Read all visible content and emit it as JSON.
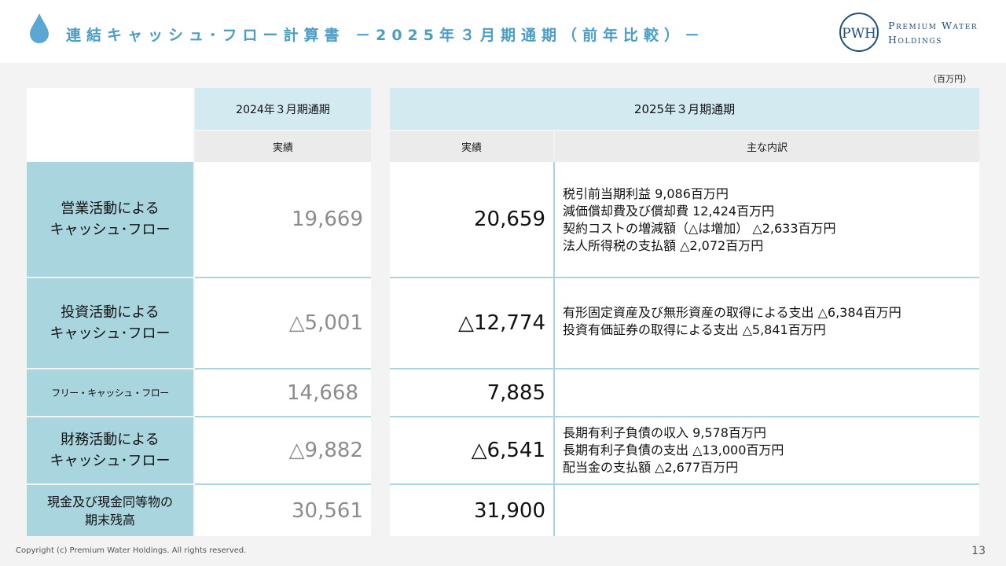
{
  "header": {
    "title": "連結キャッシュ･フロー計算書 －2025年３月期通期（前年比較）－",
    "icon": "water-drop-icon",
    "logo": {
      "monogram": "PWH",
      "line1": "Premium Water",
      "line2": "Holdings"
    }
  },
  "table": {
    "unit": "（百万円）",
    "col_prev_period": "2024年３月期通期",
    "col_curr_period": "2025年３月期通期",
    "sub_actual_prev": "実績",
    "sub_actual_curr": "実績",
    "sub_breakdown": "主な内訳",
    "rows": [
      {
        "label_1": "営業活動による",
        "label_2": "キャッシュ･フロー",
        "prev": "19,669",
        "curr": "20,659",
        "details": [
          "税引前当期利益 9,086百万円",
          "減価償却費及び償却費 12,424百万円",
          "契約コストの増減額（△は増加） △2,633百万円",
          "法人所得税の支払額 △2,072百万円"
        ]
      },
      {
        "label_1": "投資活動による",
        "label_2": "キャッシュ･フロー",
        "prev": "△5,001",
        "curr": "△12,774",
        "details": [
          "有形固定資産及び無形資産の取得による支出 △6,384百万円",
          "投資有価証券の取得による支出 △5,841百万円"
        ]
      },
      {
        "label_1": "フリー・キャッシュ・フロー",
        "prev": "14,668",
        "curr": "7,885"
      },
      {
        "label_1": "財務活動による",
        "label_2": "キャッシュ･フロー",
        "prev": "△9,882",
        "curr": "△6,541",
        "details": [
          "長期有利子負債の収入 9,578百万円",
          "長期有利子負債の支出 △13,000百万円",
          "配当金の支払額 △2,677百万円"
        ]
      },
      {
        "label_1": "現金及び現金同等物の",
        "label_2": "期末残高",
        "prev": "30,561",
        "curr": "31,900"
      }
    ]
  },
  "footer": {
    "copyright": "Copyright (c) Premium Water Holdings. All rights reserved.",
    "page": "13"
  },
  "colors": {
    "accent": "#4b9dc6",
    "header_cell": "#d2eaf0",
    "row_header": "#a9d5de",
    "sub_header": "#ebebeb",
    "logo": "#1f4e79"
  }
}
